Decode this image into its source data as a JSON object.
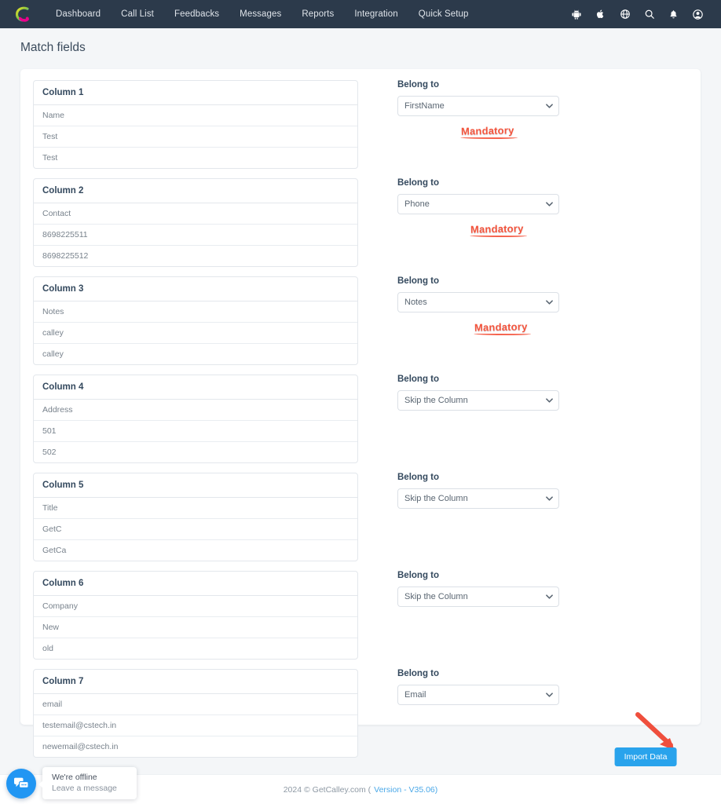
{
  "navbar": {
    "logo_name": "getcalley-logo",
    "links": [
      {
        "label": "Dashboard"
      },
      {
        "label": "Call List"
      },
      {
        "label": "Feedbacks"
      },
      {
        "label": "Messages"
      },
      {
        "label": "Reports"
      },
      {
        "label": "Integration"
      },
      {
        "label": "Quick Setup"
      }
    ],
    "icons": [
      {
        "name": "android-icon"
      },
      {
        "name": "apple-icon"
      },
      {
        "name": "globe-icon"
      },
      {
        "name": "search-icon"
      },
      {
        "name": "bell-icon"
      },
      {
        "name": "user-account-icon"
      }
    ],
    "background": "#2c3a4b"
  },
  "page": {
    "title": "Match fields"
  },
  "belong_to_label": "Belong to",
  "mandatory_label": "Mandatory",
  "mandatory_color": "#f4543c",
  "rows": [
    {
      "header": "Column 1",
      "cells": [
        "Name",
        "Test",
        "Test"
      ],
      "select_value": "FirstName",
      "options": [
        "FirstName",
        "Phone",
        "Notes",
        "Email",
        "Skip the Column"
      ],
      "mandatory": true
    },
    {
      "header": "Column 2",
      "cells": [
        "Contact",
        "8698225511",
        "8698225512"
      ],
      "select_value": "Phone",
      "options": [
        "FirstName",
        "Phone",
        "Notes",
        "Email",
        "Skip the Column"
      ],
      "mandatory": true
    },
    {
      "header": "Column 3",
      "cells": [
        "Notes",
        "calley",
        "calley"
      ],
      "select_value": "Notes",
      "options": [
        "FirstName",
        "Phone",
        "Notes",
        "Email",
        "Skip the Column"
      ],
      "mandatory": true
    },
    {
      "header": "Column 4",
      "cells": [
        "Address",
        "501",
        "502"
      ],
      "select_value": "Skip the Column",
      "options": [
        "FirstName",
        "Phone",
        "Notes",
        "Email",
        "Skip the Column"
      ],
      "mandatory": false
    },
    {
      "header": "Column 5",
      "cells": [
        "Title",
        "GetC",
        "GetCa"
      ],
      "select_value": "Skip the Column",
      "options": [
        "FirstName",
        "Phone",
        "Notes",
        "Email",
        "Skip the Column"
      ],
      "mandatory": false
    },
    {
      "header": "Column 6",
      "cells": [
        "Company",
        "New",
        "old"
      ],
      "select_value": "Skip the Column",
      "options": [
        "FirstName",
        "Phone",
        "Notes",
        "Email",
        "Skip the Column"
      ],
      "mandatory": false
    },
    {
      "header": "Column 7",
      "cells": [
        "email",
        "testemail@cstech.in",
        "newemail@cstech.in"
      ],
      "select_value": "Email",
      "options": [
        "FirstName",
        "Phone",
        "Notes",
        "Email",
        "Skip the Column"
      ],
      "mandatory": false
    }
  ],
  "actions": {
    "import_label": "Import Data",
    "import_color": "#29a3ec",
    "arrow_color": "#ef4f3d"
  },
  "footer": {
    "copyright": "2024 © GetCalley.com (",
    "version": "Version - V35.06",
    "close_paren": ")"
  },
  "chat": {
    "icon_name": "chat-bubble-icon",
    "title": "We're offline",
    "subtitle": "Leave a message"
  }
}
